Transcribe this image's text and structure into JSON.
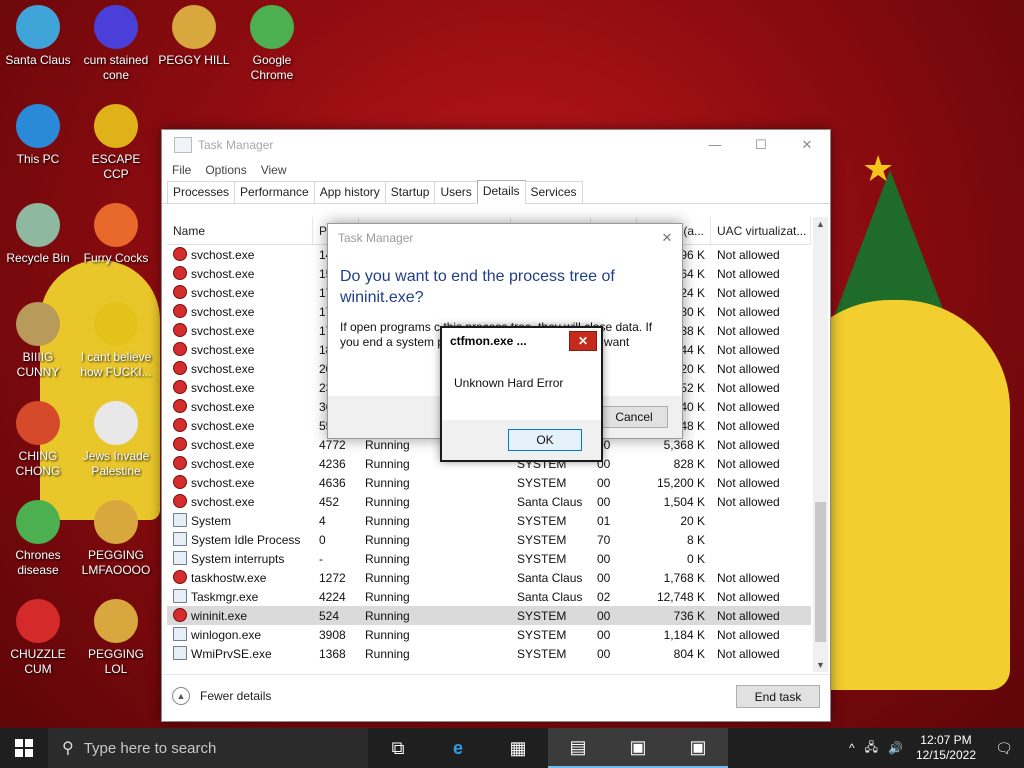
{
  "desktop_icons": [
    {
      "label": "Santa Claus",
      "icon": "user-avatar-icon",
      "color": "#3fa5d8"
    },
    {
      "label": "cum stained cone",
      "icon": "ornament-icon",
      "color": "#4a3fd8"
    },
    {
      "label": "PEGGY HILL",
      "icon": "pegging-p-icon",
      "color": "#d8a83f"
    },
    {
      "label": "Google Chrome",
      "icon": "chrome-icon",
      "color": "#4caf50"
    },
    {
      "label": "This PC",
      "icon": "computer-icon",
      "color": "#2a8ad8"
    },
    {
      "label": "ESCAPE CCP",
      "icon": "mahjong-icon",
      "color": "#e0b21a"
    },
    {
      "label": "Recycle Bin",
      "icon": "recycle-bin-icon",
      "color": "#8fb8a0"
    },
    {
      "label": "Furry Cocks",
      "icon": "firefox-icon",
      "color": "#e8672a"
    },
    {
      "label": "BIIIIG CUNNY",
      "icon": "money-bag-icon",
      "color": "#b89a5a"
    },
    {
      "label": "I cant believe how FUCKI...",
      "icon": "minion-icon",
      "color": "#e5c21a"
    },
    {
      "label": "CHING CHONG",
      "icon": "temple-gate-icon",
      "color": "#d44a2a"
    },
    {
      "label": "Jews Invade Palestine",
      "icon": "flower-icon",
      "color": "#e8e8e8"
    },
    {
      "label": "Chrones disease",
      "icon": "chrome-icon",
      "color": "#4caf50"
    },
    {
      "label": "PEGGING LMFAOOOO",
      "icon": "pegging-p-icon",
      "color": "#d8a83f"
    },
    {
      "label": "CHUZZLE CUM",
      "icon": "chuzzle-icon",
      "color": "#d42a2a"
    },
    {
      "label": "PEGGING LOL",
      "icon": "pegging-p-icon",
      "color": "#d8a83f"
    }
  ],
  "task_manager": {
    "title": "Task Manager",
    "menu": [
      "File",
      "Options",
      "View"
    ],
    "tabs": [
      "Processes",
      "Performance",
      "App history",
      "Startup",
      "Users",
      "Details",
      "Services"
    ],
    "active_tab": "Details",
    "columns": [
      "Name",
      "PI",
      "",
      "",
      "",
      "(a...",
      "UAC virtualizat..."
    ],
    "rows": [
      {
        "name": "svchost.exe",
        "pid": "14",
        "status": "",
        "user": "",
        "cpu": "",
        "mem": "96 K",
        "uac": "Not allowed"
      },
      {
        "name": "svchost.exe",
        "pid": "15",
        "status": "",
        "user": "",
        "cpu": "",
        "mem": "64 K",
        "uac": "Not allowed"
      },
      {
        "name": "svchost.exe",
        "pid": "17",
        "status": "",
        "user": "",
        "cpu": "",
        "mem": "24 K",
        "uac": "Not allowed"
      },
      {
        "name": "svchost.exe",
        "pid": "17",
        "status": "",
        "user": "",
        "cpu": "",
        "mem": "80 K",
        "uac": "Not allowed"
      },
      {
        "name": "svchost.exe",
        "pid": "17",
        "status": "",
        "user": "",
        "cpu": "",
        "mem": "38 K",
        "uac": "Not allowed"
      },
      {
        "name": "svchost.exe",
        "pid": "18",
        "status": "",
        "user": "",
        "cpu": "",
        "mem": "44 K",
        "uac": "Not allowed"
      },
      {
        "name": "svchost.exe",
        "pid": "20",
        "status": "",
        "user": "",
        "cpu": "",
        "mem": "20 K",
        "uac": "Not allowed"
      },
      {
        "name": "svchost.exe",
        "pid": "23",
        "status": "",
        "user": "",
        "cpu": "",
        "mem": "52 K",
        "uac": "Not allowed"
      },
      {
        "name": "svchost.exe",
        "pid": "36",
        "status": "",
        "user": "",
        "cpu": "",
        "mem": "40 K",
        "uac": "Not allowed"
      },
      {
        "name": "svchost.exe",
        "pid": "55",
        "status": "",
        "user": "",
        "cpu": "",
        "mem": "48 K",
        "uac": "Not allowed"
      },
      {
        "name": "svchost.exe",
        "pid": "4772",
        "status": "Running",
        "user": "",
        "cpu": "00",
        "mem": "5,368 K",
        "uac": "Not allowed"
      },
      {
        "name": "svchost.exe",
        "pid": "4236",
        "status": "Running",
        "user": "SYSTEM",
        "cpu": "00",
        "mem": "828 K",
        "uac": "Not allowed"
      },
      {
        "name": "svchost.exe",
        "pid": "4636",
        "status": "Running",
        "user": "SYSTEM",
        "cpu": "00",
        "mem": "15,200 K",
        "uac": "Not allowed"
      },
      {
        "name": "svchost.exe",
        "pid": "452",
        "status": "Running",
        "user": "Santa Claus",
        "cpu": "00",
        "mem": "1,504 K",
        "uac": "Not allowed"
      },
      {
        "name": "System",
        "pid": "4",
        "status": "Running",
        "user": "SYSTEM",
        "cpu": "01",
        "mem": "20 K",
        "uac": ""
      },
      {
        "name": "System Idle Process",
        "pid": "0",
        "status": "Running",
        "user": "SYSTEM",
        "cpu": "70",
        "mem": "8 K",
        "uac": ""
      },
      {
        "name": "System interrupts",
        "pid": "-",
        "status": "Running",
        "user": "SYSTEM",
        "cpu": "00",
        "mem": "0 K",
        "uac": ""
      },
      {
        "name": "taskhostw.exe",
        "pid": "1272",
        "status": "Running",
        "user": "Santa Claus",
        "cpu": "00",
        "mem": "1,768 K",
        "uac": "Not allowed"
      },
      {
        "name": "Taskmgr.exe",
        "pid": "4224",
        "status": "Running",
        "user": "Santa Claus",
        "cpu": "02",
        "mem": "12,748 K",
        "uac": "Not allowed"
      },
      {
        "name": "wininit.exe",
        "pid": "524",
        "status": "Running",
        "user": "SYSTEM",
        "cpu": "00",
        "mem": "736 K",
        "uac": "Not allowed"
      },
      {
        "name": "winlogon.exe",
        "pid": "3908",
        "status": "Running",
        "user": "SYSTEM",
        "cpu": "00",
        "mem": "1,184 K",
        "uac": "Not allowed"
      },
      {
        "name": "WmiPrvSE.exe",
        "pid": "1368",
        "status": "Running",
        "user": "SYSTEM",
        "cpu": "00",
        "mem": "804 K",
        "uac": "Not allowed"
      }
    ],
    "selected_row": "wininit.exe",
    "fewer_details": "Fewer details",
    "end_task": "End task"
  },
  "confirm_dialog": {
    "title": "Task Manager",
    "heading": "Do you want to end the process tree of wininit.exe?",
    "body": "If open programs c                                              this process tree, they will close                                   data. If you end a system proce                                tability. Are you sure you want",
    "cancel": "Cancel"
  },
  "error_dialog": {
    "title": "ctfmon.exe ...",
    "message": "Unknown Hard Error",
    "ok": "OK"
  },
  "taskbar": {
    "search_placeholder": "Type here to search",
    "time": "12:07 PM",
    "date": "12/15/2022"
  }
}
